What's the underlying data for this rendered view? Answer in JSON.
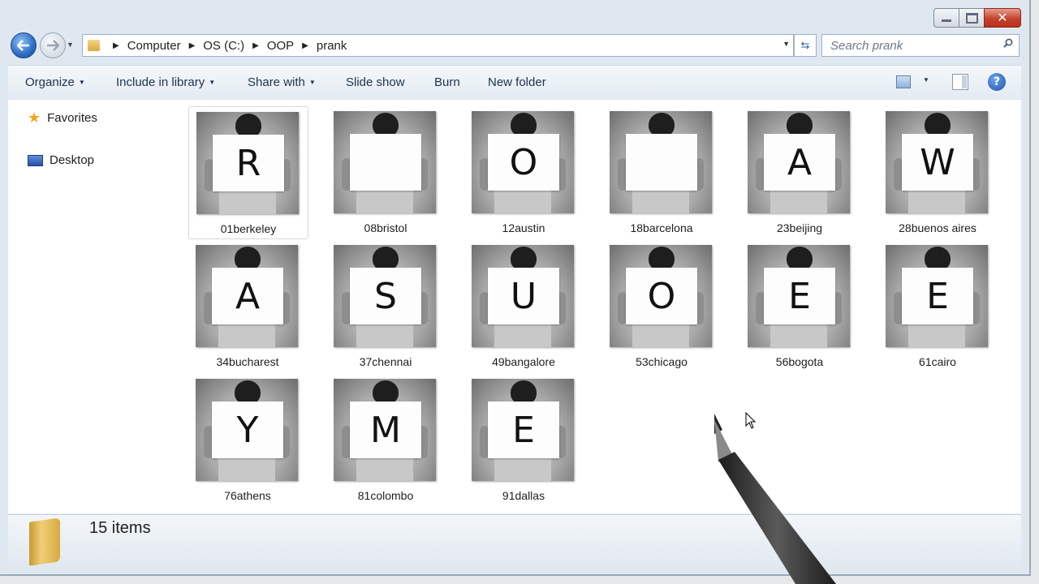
{
  "window": {
    "caption": {
      "minimize": "minimize",
      "maximize": "maximize",
      "close": "✕"
    }
  },
  "address_bar": {
    "breadcrumbs": [
      "Computer",
      "OS (C:)",
      "OOP",
      "prank"
    ]
  },
  "search": {
    "placeholder": "Search prank"
  },
  "toolbar": {
    "organize": "Organize",
    "include_in_library": "Include in library",
    "share_with": "Share with",
    "slide_show": "Slide show",
    "burn": "Burn",
    "new_folder": "New folder",
    "help": "?"
  },
  "sidebar": {
    "items": [
      {
        "label": "Favorites",
        "icon": "star-icon"
      },
      {
        "label": "Desktop",
        "icon": "desktop-icon"
      }
    ]
  },
  "files": [
    {
      "name": "01berkeley",
      "letter": "R"
    },
    {
      "name": "08bristol",
      "letter": ""
    },
    {
      "name": "12austin",
      "letter": "O"
    },
    {
      "name": "18barcelona",
      "letter": ""
    },
    {
      "name": "23beijing",
      "letter": "A"
    },
    {
      "name": "28buenos aires",
      "letter": "W"
    },
    {
      "name": "34bucharest",
      "letter": "A"
    },
    {
      "name": "37chennai",
      "letter": "S"
    },
    {
      "name": "49bangalore",
      "letter": "U"
    },
    {
      "name": "53chicago",
      "letter": "O"
    },
    {
      "name": "56bogota",
      "letter": "E"
    },
    {
      "name": "61cairo",
      "letter": "E"
    },
    {
      "name": "76athens",
      "letter": "Y"
    },
    {
      "name": "81colombo",
      "letter": "M"
    },
    {
      "name": "91dallas",
      "letter": "E"
    }
  ],
  "status": {
    "item_count": "15 items"
  },
  "colors": {
    "accent": "#2b6cc4",
    "close_button": "#c4432d",
    "window_chrome": "#dfe8f1"
  }
}
